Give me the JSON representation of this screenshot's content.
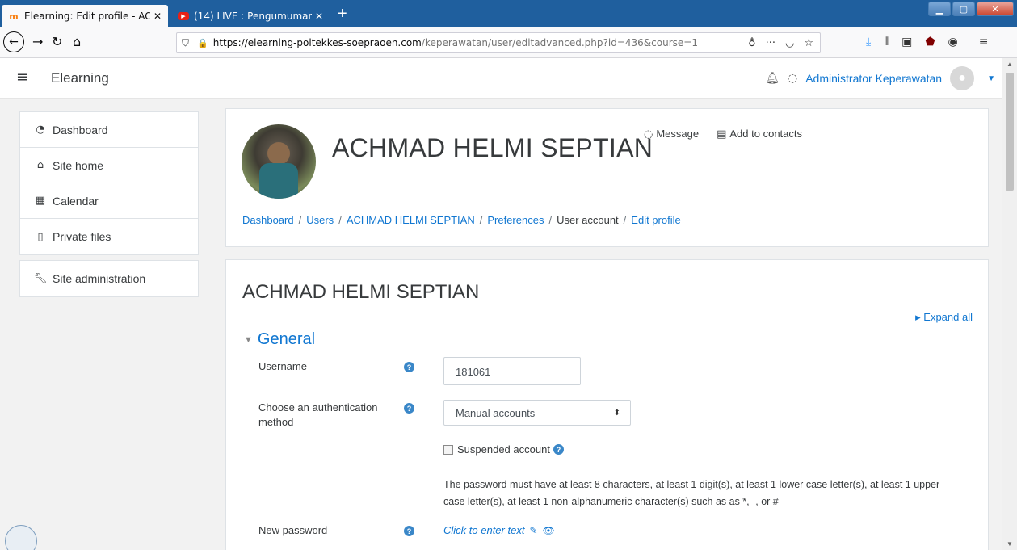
{
  "browser": {
    "tabs": [
      {
        "title": "Elearning: Edit profile - ACHMA",
        "close": "✕",
        "favicon": "moodle-icon"
      },
      {
        "title": "(14) LIVE : Pengumuman Penye",
        "close": "✕",
        "favicon": "youtube-icon"
      }
    ],
    "new_tab": "+",
    "url_host": "https://elearning-poltekkes-soepraoen.com",
    "url_path": "/keperawatan/user/editadvanced.php?id=436&course=1",
    "window_controls": {
      "min": "▁",
      "max": "▢",
      "close": "✕"
    }
  },
  "header": {
    "site_name": "Elearning",
    "user_name": "Administrator Keperawatan"
  },
  "nav": {
    "group1": [
      {
        "label": "Dashboard",
        "icon": "tachometer-icon"
      },
      {
        "label": "Site home",
        "icon": "home-icon"
      },
      {
        "label": "Calendar",
        "icon": "calendar-icon"
      },
      {
        "label": "Private files",
        "icon": "file-icon"
      }
    ],
    "group2": [
      {
        "label": "Site administration",
        "icon": "wrench-icon"
      }
    ]
  },
  "profile": {
    "full_name": "ACHMAD HELMI SEPTIAN",
    "message_label": "Message",
    "add_contacts_label": "Add to contacts",
    "breadcrumb": [
      {
        "label": "Dashboard",
        "link": true
      },
      {
        "label": "Users",
        "link": true
      },
      {
        "label": "ACHMAD HELMI SEPTIAN",
        "link": true
      },
      {
        "label": "Preferences",
        "link": true
      },
      {
        "label": "User account",
        "link": false
      },
      {
        "label": "Edit profile",
        "link": true
      }
    ]
  },
  "form": {
    "heading": "ACHMAD HELMI SEPTIAN",
    "expand_all": "Expand all",
    "section": "General",
    "username_label": "Username",
    "username_value": "181061",
    "auth_label": "Choose an authentication method",
    "auth_value": "Manual accounts",
    "suspended_label": "Suspended account",
    "password_note": "The password must have at least 8 characters, at least 1 digit(s), at least 1 lower case letter(s), at least 1 upper case letter(s), at least 1 non-alphanumeric character(s) such as as *, -, or #",
    "new_password_label": "New password",
    "new_password_click": "Click to enter text"
  },
  "colors": {
    "link": "#1177d1",
    "tabbar": "#1f5f9e",
    "help": "#3a87c8"
  }
}
